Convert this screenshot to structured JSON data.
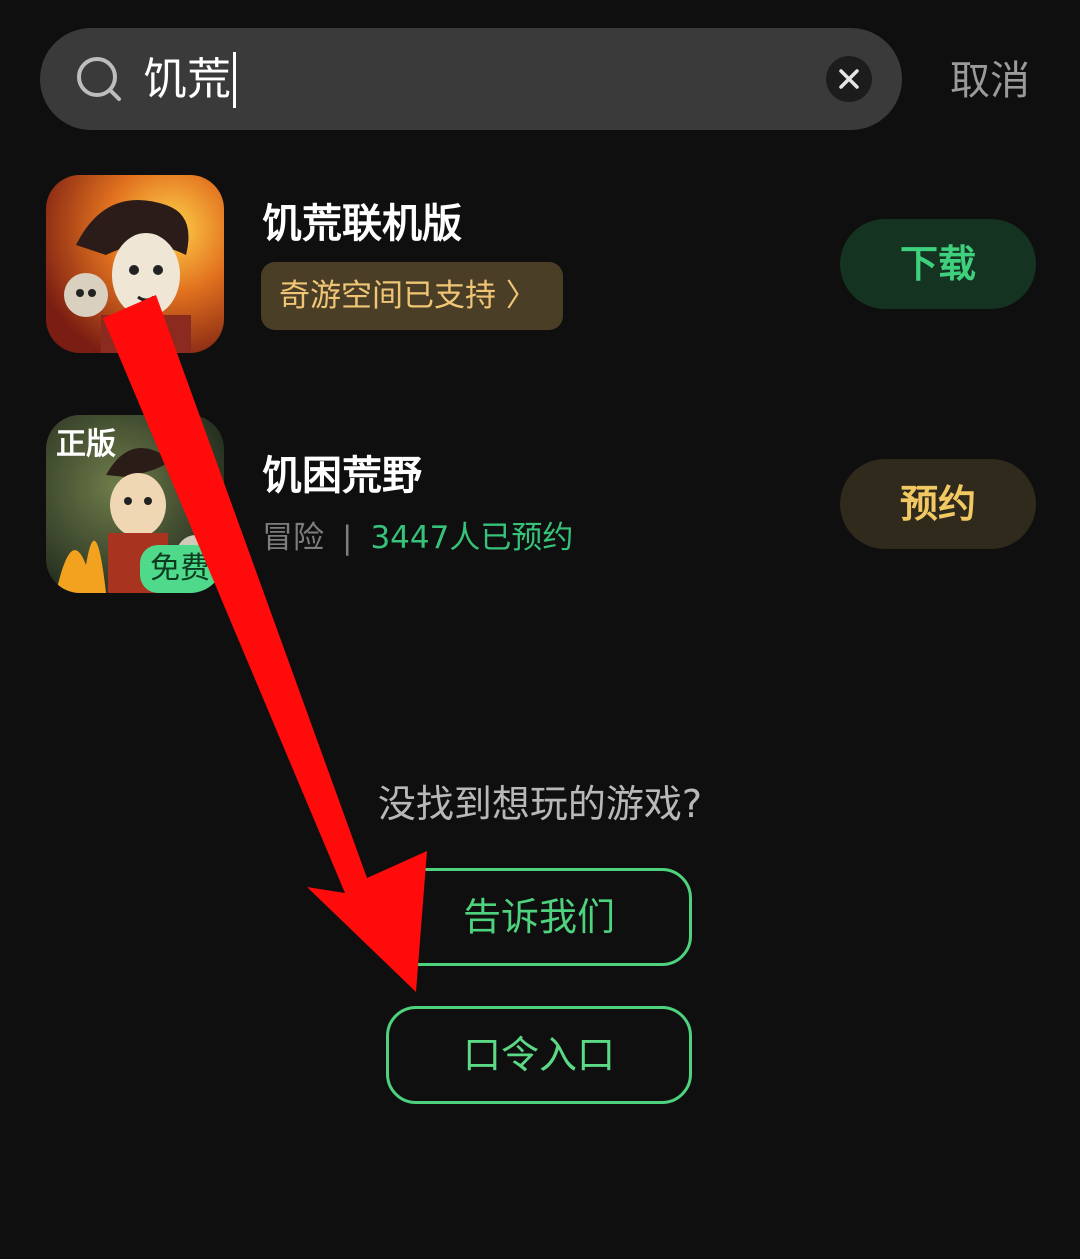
{
  "search": {
    "query": "饥荒",
    "cancel_label": "取消"
  },
  "results": [
    {
      "title": "饥荒联机版",
      "badge": "奇游空间已支持 〉",
      "action_label": "下载"
    },
    {
      "title": "饥困荒野",
      "icon_tag": "正版",
      "free_tag": "免费",
      "category": "冒险",
      "separator": "|",
      "reservations": "3447人已预约",
      "action_label": "预约"
    }
  ],
  "empty_state": {
    "prompt": "没找到想玩的游戏?",
    "tell_us_label": "告诉我们",
    "code_entry_label": "口令入口"
  },
  "colors": {
    "background": "#0f0f0f",
    "accent_green": "#4ed27e",
    "accent_gold": "#f2c862",
    "annotation_red": "#ff0b0b"
  },
  "icons": [
    "search-icon",
    "clear-icon"
  ]
}
